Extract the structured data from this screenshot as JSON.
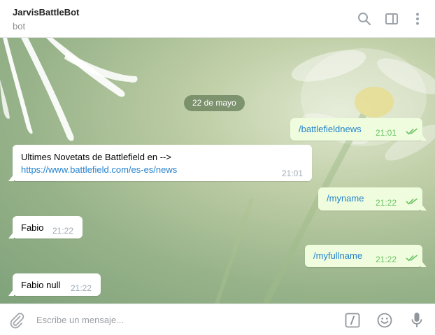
{
  "header": {
    "title": "JarvisBattleBot",
    "subtitle": "bot",
    "icons": [
      "search-icon",
      "sidebar-toggle-icon",
      "more-vert-icon"
    ]
  },
  "chat": {
    "date_divider": "22 de mayo",
    "messages": [
      {
        "direction": "out",
        "text": "/battlefieldnews",
        "time": "21:01",
        "status": "read"
      },
      {
        "direction": "in",
        "text": "Ultimes Novetats de Battlefield en -->",
        "link": "https://www.battlefield.com/es-es/news",
        "time": "21:01"
      },
      {
        "direction": "out",
        "text": "/myname",
        "time": "21:22",
        "status": "read"
      },
      {
        "direction": "in",
        "text": "Fabio",
        "time": "21:22"
      },
      {
        "direction": "out",
        "text": "/myfullname",
        "time": "21:22",
        "status": "read"
      },
      {
        "direction": "in",
        "text": "Fabio null",
        "time": "21:22"
      }
    ]
  },
  "composer": {
    "placeholder": "Escribe un mensaje...",
    "icons": [
      "attach-icon",
      "bot-command-icon",
      "emoji-icon",
      "microphone-icon"
    ]
  },
  "colors": {
    "link": "#2481cc",
    "outgoing_bubble": "#effdde",
    "read_ticks": "#6cc264",
    "date_pill": "#647d5a"
  }
}
